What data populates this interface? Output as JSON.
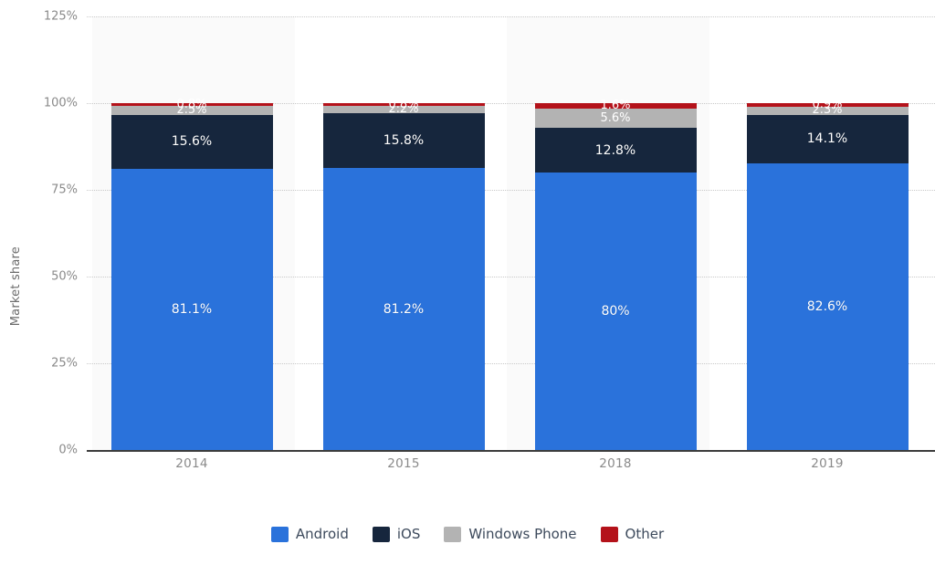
{
  "chart_data": {
    "type": "bar",
    "stacked": true,
    "title": "",
    "xlabel": "",
    "ylabel": "Market share",
    "categories": [
      "2014",
      "2015",
      "2018",
      "2019"
    ],
    "ylim": [
      0,
      125
    ],
    "ytick_labels": [
      "0%",
      "25%",
      "50%",
      "75%",
      "100%",
      "125%"
    ],
    "ytick_values": [
      0,
      25,
      50,
      75,
      100,
      125
    ],
    "grid": true,
    "legend_position": "bottom",
    "series": [
      {
        "name": "Android",
        "color": "#2a72db",
        "values": [
          81.1,
          81.2,
          80.0,
          82.6
        ],
        "labels": [
          "81.1%",
          "81.2%",
          "80%",
          "82.6%"
        ]
      },
      {
        "name": "iOS",
        "color": "#16263d",
        "values": [
          15.6,
          15.8,
          12.8,
          14.1
        ],
        "labels": [
          "15.6%",
          "15.8%",
          "12.8%",
          "14.1%"
        ]
      },
      {
        "name": "Windows Phone",
        "color": "#b3b3b3",
        "values": [
          2.5,
          2.2,
          5.6,
          2.3
        ],
        "labels": [
          "2.5%",
          "2.2%",
          "5.6%",
          "2.3%"
        ]
      },
      {
        "name": "Other",
        "color": "#b4121a",
        "values": [
          0.8,
          0.8,
          1.6,
          0.9
        ],
        "labels": [
          "0.8%",
          "0.8%",
          "1.6%",
          "0.9%"
        ]
      }
    ]
  },
  "axis": {
    "y_title": "Market share"
  },
  "legend": {
    "items": [
      {
        "label": "Android",
        "color": "#2a72db"
      },
      {
        "label": "iOS",
        "color": "#16263d"
      },
      {
        "label": "Windows Phone",
        "color": "#b3b3b3"
      },
      {
        "label": "Other",
        "color": "#b4121a"
      }
    ]
  },
  "ticks": {
    "y": [
      "125%",
      "100%",
      "75%",
      "50%",
      "25%",
      "0%"
    ],
    "x": [
      "2014",
      "2015",
      "2018",
      "2019"
    ]
  }
}
